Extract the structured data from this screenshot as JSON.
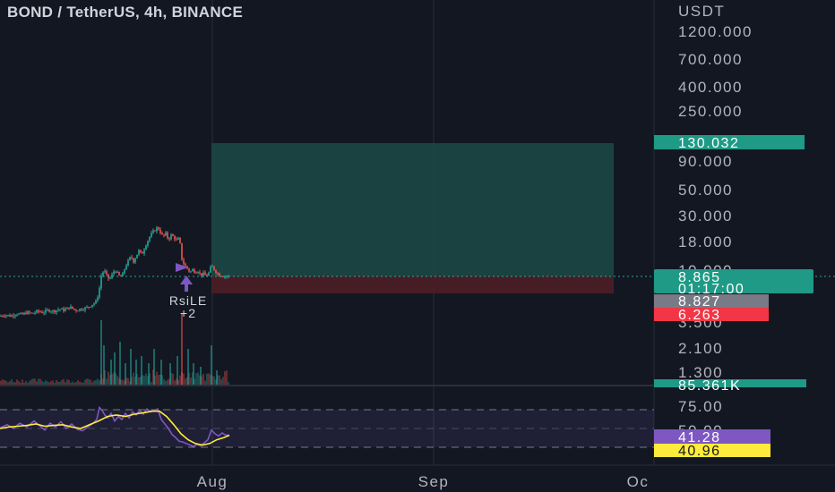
{
  "header": {
    "title": "BOND / TetherUS, 4h, BINANCE"
  },
  "price_axis": {
    "currency": "USDT",
    "ticks": [
      "1200.000",
      "700.000",
      "400.000",
      "250.000",
      "90.000",
      "50.000",
      "30.000",
      "18.000",
      "10.000",
      "3.500",
      "2.100",
      "1.300"
    ]
  },
  "badges": {
    "target": "130.032",
    "last": "8.865",
    "countdown": "01:17:00",
    "mid": "8.827",
    "stop": "6.263",
    "volume": "85.361K"
  },
  "signal": {
    "name": "RsiLE",
    "value": "+2"
  },
  "time_axis": {
    "labels": [
      "Aug",
      "Sep",
      "Oc"
    ]
  },
  "rsi_panel": {
    "ticks": [
      "75.00",
      "50.00"
    ],
    "rsi_value": "41.28",
    "ma_value": "40.96"
  },
  "colors": {
    "background": "#131722",
    "up": "#26a69a",
    "down": "#ef5350",
    "target_zone": "#1c4a45",
    "stop_zone": "#4a1e26",
    "rsi_line": "#7e57c2",
    "rsi_ma": "#ffeb3b",
    "badge_green": "#1e9a86",
    "badge_red": "#f23645",
    "badge_gray": "#787b86"
  },
  "chart_data": {
    "type": "candlestick",
    "title": "BOND / TetherUS, 4h, BINANCE",
    "x_labels": [
      "Aug",
      "Sep",
      "Oc"
    ],
    "y_scale": "log",
    "y_ticks": [
      1.3,
      2.1,
      3.5,
      10,
      18,
      30,
      50,
      90,
      250,
      400,
      700,
      1200
    ],
    "last_price": 8.865,
    "position": {
      "entry": 8.827,
      "target": 130.032,
      "stop": 6.263
    },
    "price_path": [
      [
        0,
        4.0
      ],
      [
        6,
        4.1
      ],
      [
        12,
        4.0
      ],
      [
        18,
        4.2
      ],
      [
        24,
        4.1
      ],
      [
        30,
        4.3
      ],
      [
        36,
        4.2
      ],
      [
        42,
        4.4
      ],
      [
        48,
        4.3
      ],
      [
        54,
        4.5
      ],
      [
        60,
        4.4
      ],
      [
        66,
        4.6
      ],
      [
        72,
        4.5
      ],
      [
        78,
        4.8
      ],
      [
        84,
        4.5
      ],
      [
        90,
        4.6
      ],
      [
        96,
        4.7
      ],
      [
        100,
        4.9
      ],
      [
        104,
        5.1
      ],
      [
        108,
        5.4
      ],
      [
        111,
        7.0
      ],
      [
        113,
        9.0
      ],
      [
        116,
        10.0
      ],
      [
        119,
        9.0
      ],
      [
        122,
        8.3
      ],
      [
        125,
        9.1
      ],
      [
        128,
        10.1
      ],
      [
        131,
        9.4
      ],
      [
        134,
        8.7
      ],
      [
        137,
        9.2
      ],
      [
        140,
        10.8
      ],
      [
        143,
        12.0
      ],
      [
        146,
        13.2
      ],
      [
        149,
        12.0
      ],
      [
        152,
        13.3
      ],
      [
        155,
        14.8
      ],
      [
        158,
        13.6
      ],
      [
        161,
        15.5
      ],
      [
        164,
        17.5
      ],
      [
        167,
        19.5
      ],
      [
        170,
        21.2
      ],
      [
        173,
        22.5
      ],
      [
        176,
        23.6
      ],
      [
        179,
        21.5
      ],
      [
        182,
        19.6
      ],
      [
        185,
        20.8
      ],
      [
        188,
        18.5
      ],
      [
        191,
        20.2
      ],
      [
        194,
        19.5
      ],
      [
        197,
        18.2
      ],
      [
        200,
        19.0
      ],
      [
        203,
        12.5
      ],
      [
        206,
        11.0
      ],
      [
        209,
        10.4
      ],
      [
        212,
        9.6
      ],
      [
        215,
        10.1
      ],
      [
        218,
        9.7
      ],
      [
        221,
        9.9
      ],
      [
        224,
        9.1
      ],
      [
        227,
        9.3
      ],
      [
        230,
        8.9
      ],
      [
        233,
        9.5
      ],
      [
        236,
        11.0
      ],
      [
        239,
        10.2
      ],
      [
        242,
        9.5
      ],
      [
        245,
        9.1
      ],
      [
        248,
        9.0
      ],
      [
        251,
        8.9
      ],
      [
        255,
        8.87
      ]
    ],
    "volume_spikes": [
      [
        113,
        0.9
      ],
      [
        116,
        0.55
      ],
      [
        124,
        0.35
      ],
      [
        128,
        0.45
      ],
      [
        134,
        0.6
      ],
      [
        140,
        0.3
      ],
      [
        146,
        0.5
      ],
      [
        152,
        0.35
      ],
      [
        158,
        0.4
      ],
      [
        166,
        0.3
      ],
      [
        172,
        0.5
      ],
      [
        180,
        0.35
      ],
      [
        190,
        0.3
      ],
      [
        198,
        0.4
      ],
      [
        203,
        1.0
      ],
      [
        210,
        0.5
      ],
      [
        216,
        0.3
      ],
      [
        224,
        0.25
      ],
      [
        236,
        0.55
      ],
      [
        242,
        0.2
      ]
    ],
    "rsi_ticks": [
      75,
      50
    ],
    "rsi_last": 41.28,
    "rsi_ma_last": 40.96,
    "rsi_path": [
      [
        0,
        51
      ],
      [
        8,
        55
      ],
      [
        15,
        50
      ],
      [
        22,
        57
      ],
      [
        30,
        52
      ],
      [
        38,
        60
      ],
      [
        44,
        54
      ],
      [
        50,
        48
      ],
      [
        56,
        57
      ],
      [
        62,
        52
      ],
      [
        68,
        59
      ],
      [
        74,
        50
      ],
      [
        80,
        56
      ],
      [
        86,
        49
      ],
      [
        92,
        47
      ],
      [
        98,
        52
      ],
      [
        104,
        57
      ],
      [
        108,
        62
      ],
      [
        111,
        78
      ],
      [
        114,
        74
      ],
      [
        117,
        68
      ],
      [
        120,
        64
      ],
      [
        124,
        70
      ],
      [
        128,
        60
      ],
      [
        132,
        66
      ],
      [
        136,
        62
      ],
      [
        140,
        70
      ],
      [
        144,
        64
      ],
      [
        148,
        72
      ],
      [
        152,
        68
      ],
      [
        156,
        74
      ],
      [
        160,
        69
      ],
      [
        164,
        76
      ],
      [
        168,
        72
      ],
      [
        172,
        74
      ],
      [
        176,
        76
      ],
      [
        180,
        62
      ],
      [
        184,
        56
      ],
      [
        188,
        50
      ],
      [
        192,
        42
      ],
      [
        196,
        38
      ],
      [
        200,
        33
      ],
      [
        204,
        32
      ],
      [
        208,
        30
      ],
      [
        212,
        28
      ],
      [
        216,
        26
      ],
      [
        220,
        29
      ],
      [
        224,
        27
      ],
      [
        228,
        31
      ],
      [
        232,
        35
      ],
      [
        236,
        48
      ],
      [
        240,
        43
      ],
      [
        244,
        40
      ],
      [
        248,
        44
      ],
      [
        252,
        41
      ],
      [
        256,
        41.3
      ]
    ],
    "rsi_ma_path": [
      [
        0,
        50
      ],
      [
        10,
        52
      ],
      [
        20,
        53
      ],
      [
        30,
        54
      ],
      [
        40,
        56
      ],
      [
        50,
        53
      ],
      [
        60,
        54
      ],
      [
        70,
        55
      ],
      [
        80,
        52
      ],
      [
        90,
        50
      ],
      [
        100,
        55
      ],
      [
        110,
        60
      ],
      [
        120,
        66
      ],
      [
        130,
        68
      ],
      [
        140,
        66
      ],
      [
        150,
        69
      ],
      [
        160,
        71
      ],
      [
        170,
        73
      ],
      [
        178,
        73
      ],
      [
        186,
        66
      ],
      [
        194,
        55
      ],
      [
        202,
        43
      ],
      [
        210,
        35
      ],
      [
        218,
        30
      ],
      [
        226,
        28
      ],
      [
        234,
        30
      ],
      [
        242,
        35
      ],
      [
        250,
        38
      ],
      [
        256,
        41
      ]
    ]
  }
}
